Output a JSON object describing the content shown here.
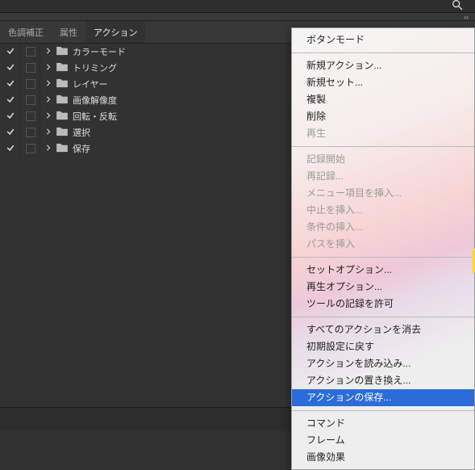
{
  "tabs": {
    "t0": "色調補正",
    "t1": "属性",
    "t2": "アクション"
  },
  "collapse_glyph": "››",
  "actions": [
    {
      "label": "カラーモード"
    },
    {
      "label": "トリミング"
    },
    {
      "label": "レイヤー"
    },
    {
      "label": "画像解像度"
    },
    {
      "label": "回転・反転"
    },
    {
      "label": "選択"
    },
    {
      "label": "保存"
    }
  ],
  "menu": {
    "g0": [
      "ボタンモード"
    ],
    "g1": [
      "新規アクション...",
      "新規セット...",
      "複製",
      "削除",
      "再生"
    ],
    "g2": [
      "記録開始",
      "再記録...",
      "メニュー項目を挿入...",
      "中止を挿入...",
      "条件の挿入...",
      "パスを挿入"
    ],
    "g3": [
      "セットオプション...",
      "再生オプション...",
      "ツールの記録を許可"
    ],
    "g4": [
      "すべてのアクションを消去",
      "初期設定に戻す",
      "アクションを読み込み...",
      "アクションの置き換え...",
      "アクションの保存..."
    ],
    "g5": [
      "コマンド",
      "フレーム",
      "画像効果"
    ]
  }
}
